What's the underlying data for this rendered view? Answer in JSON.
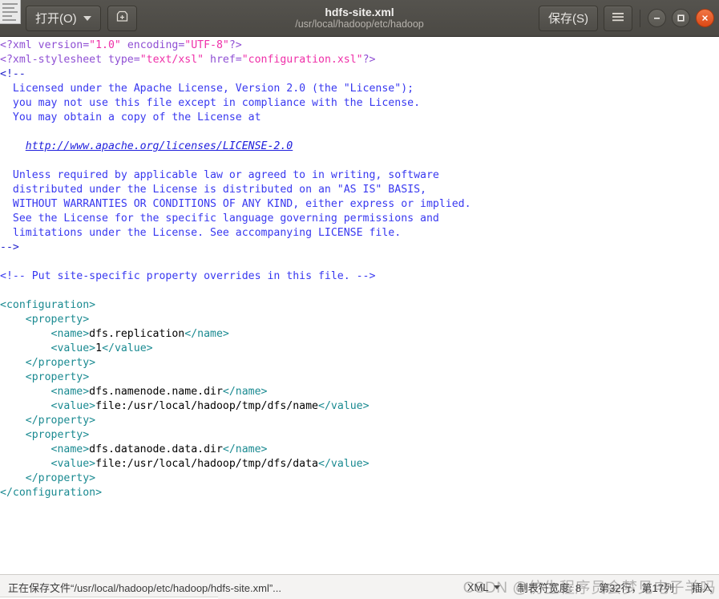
{
  "titlebar": {
    "open_button_label": "打开(O)",
    "open_button_icon": "chevron-down-icon",
    "save_icon_button_icon": "save-disk-icon",
    "save_button_label": "保存(S)",
    "menu_button_icon": "hamburger-menu-icon",
    "file_name": "hdfs-site.xml",
    "file_path": "/usr/local/hadoop/etc/hadoop",
    "minimize_icon": "minimize-icon",
    "maximize_icon": "maximize-icon",
    "close_icon": "close-icon",
    "doc_glyph_icon": "document-icon"
  },
  "editor": {
    "lines": {
      "l01_pi_open": "<?xml ",
      "l01_attr1": "version=",
      "l01_val1": "\"1.0\"",
      "l01_attr2": " encoding=",
      "l01_val2": "\"UTF-8\"",
      "l01_pi_close": "?>",
      "l02_pi_open": "<?xml-stylesheet ",
      "l02_attr1": "type=",
      "l02_val1": "\"text/xsl\"",
      "l02_attr2": " href=",
      "l02_val2": "\"configuration.xsl\"",
      "l02_pi_close": "?>",
      "comment_open": "<!--",
      "c1": "  Licensed under the Apache License, Version 2.0 (the \"License\");",
      "c2": "  you may not use this file except in compliance with the License.",
      "c3": "  You may obtain a copy of the License at",
      "c4_blank": "",
      "c5_link_indent": "    ",
      "c5_link": "http://www.apache.org/licenses/LICENSE-2.0",
      "c6_blank": "",
      "c7": "  Unless required by applicable law or agreed to in writing, software",
      "c8": "  distributed under the License is distributed on an \"AS IS\" BASIS,",
      "c9": "  WITHOUT WARRANTIES OR CONDITIONS OF ANY KIND, either express or implied.",
      "c10": "  See the License for the specific language governing permissions and",
      "c11": "  limitations under the License. See accompanying LICENSE file.",
      "comment_close": "-->",
      "site_comment": "<!-- Put site-specific property overrides in this file. -->",
      "cfg_open": "<configuration>",
      "prop_open": "    <property>",
      "name_open": "        <name>",
      "name_close": "</name>",
      "value_open": "<value>",
      "value_close": "</value>",
      "prop_close": "    </property>",
      "cfg_close": "</configuration>",
      "p1_name": "dfs.replication",
      "p1_value": "1",
      "p2_name": "dfs.namenode.name.dir",
      "p2_value": "file:/usr/local/hadoop/tmp/dfs/name",
      "p3_name": "dfs.datanode.data.dir",
      "p3_value": "file:/usr/local/hadoop/tmp/dfs/data",
      "value_indent": "        "
    }
  },
  "statusbar": {
    "message": "正在保存文件“/usr/local/hadoop/etc/hadoop/hdfs-site.xml”...",
    "language": "XML",
    "language_caret_icon": "chevron-down-icon",
    "tab_width": "制表符宽度: 8",
    "cursor_position": "第32行，第17列",
    "insert_mode": "插入"
  },
  "watermark": {
    "text": "CSDN @仿生程序员会梦见电子羊吗"
  },
  "colors": {
    "titlebar_bg": "#4f4d48",
    "editor_bg": "#ffffff",
    "statusbar_bg": "#f4f3f2",
    "tag_teal": "#1a8a91",
    "comment_blue": "#3838f0",
    "pi_purple": "#8f4fd4",
    "string_magenta": "#ef2fa8",
    "close_orange": "#dd4814"
  }
}
